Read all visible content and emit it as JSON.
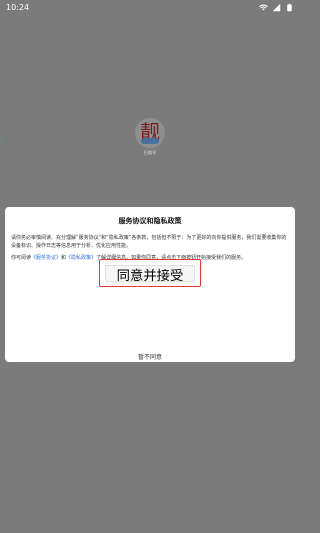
{
  "status_bar": {
    "time": "10:24",
    "icons": [
      "wifi-icon",
      "signal-icon",
      "battery-icon"
    ]
  },
  "background": {
    "logo_char": "靓",
    "logo_label": "扫描号"
  },
  "dialog": {
    "title": "服务协议和隐私政策",
    "paragraph1": "请你务必审慎阅读、充分理解“服务协议”和“隐私政策”各条款，包括但不限于：为了更好的向你提供服务，我们需要收集你的设备标识、操作日志等信息用于分析、优化应用性能。",
    "paragraph2_prefix": "你可阅读",
    "service_link": "《服务协议》",
    "paragraph2_and": "和",
    "privacy_link": "《隐私政策》",
    "paragraph2_suffix": "了解详细信息。如果你同意，请点击下面按钮开始接受我们的服务。",
    "agree_label": "同意并接受",
    "disagree_label": "暂不同意"
  },
  "colors": {
    "link": "#2f6fd6",
    "highlight_border": "#e53935",
    "backdrop": "#7b7b7b"
  }
}
